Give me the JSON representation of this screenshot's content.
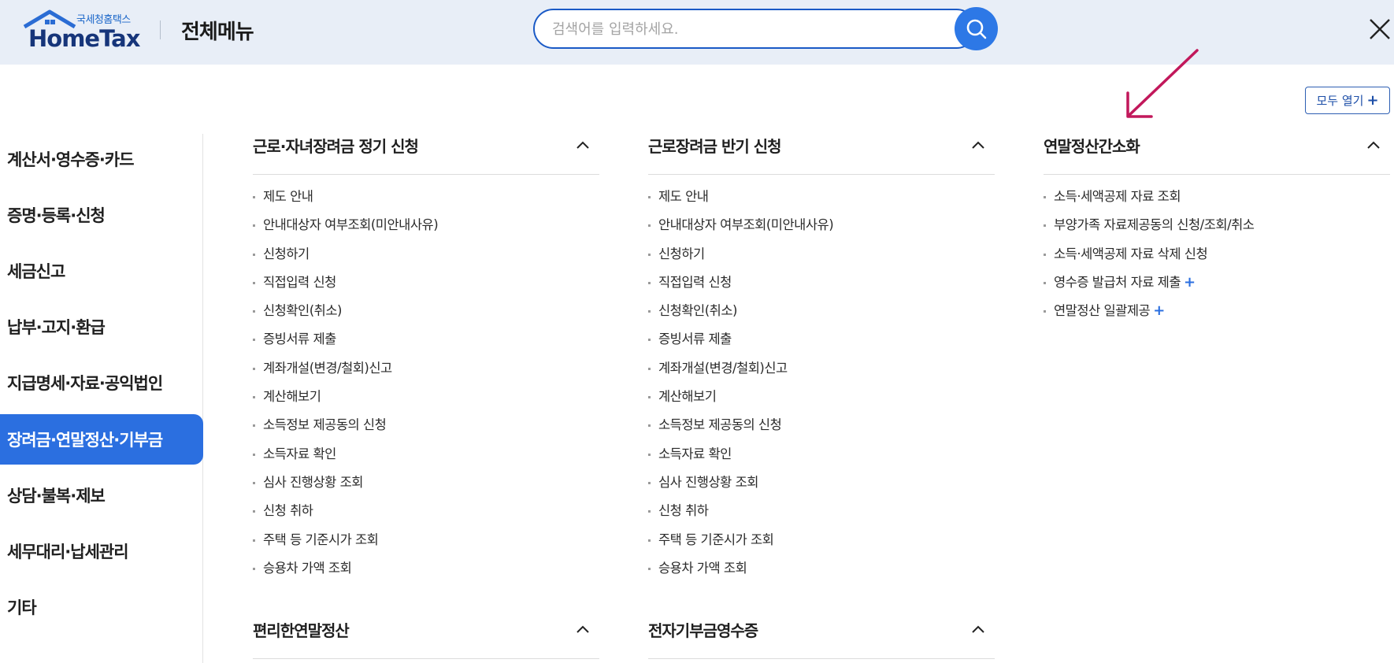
{
  "header": {
    "logo_sub": "국세청홈택스",
    "logo_main": "HomeTax",
    "page_title": "전체메뉴",
    "search_placeholder": "검색어를 입력하세요."
  },
  "expand_all_label": "모두 열기",
  "expand_all_icon": "+",
  "nav": [
    "계산서·영수증·카드",
    "증명·등록·신청",
    "세금신고",
    "납부·고지·환급",
    "지급명세·자료·공익법인",
    "장려금·연말정산·기부금",
    "상담·불복·제보",
    "세무대리·납세관리",
    "기타"
  ],
  "active_nav_index": 5,
  "columns": [
    {
      "title": "근로·자녀장려금 정기 신청",
      "links": [
        "제도 안내",
        "안내대상자 여부조회(미안내사유)",
        "신청하기",
        "직접입력 신청",
        "신청확인(취소)",
        "증빙서류 제출",
        "계좌개설(변경/철회)신고",
        "계산해보기",
        "소득정보 제공동의 신청",
        "소득자료 확인",
        "심사 진행상황 조회",
        "신청 취하",
        "주택 등 기준시가 조회",
        "승용차 가액 조회"
      ],
      "next_title": "편리한연말정산"
    },
    {
      "title": "근로장려금 반기 신청",
      "links": [
        "제도 안내",
        "안내대상자 여부조회(미안내사유)",
        "신청하기",
        "직접입력 신청",
        "신청확인(취소)",
        "증빙서류 제출",
        "계좌개설(변경/철회)신고",
        "계산해보기",
        "소득정보 제공동의 신청",
        "소득자료 확인",
        "심사 진행상황 조회",
        "신청 취하",
        "주택 등 기준시가 조회",
        "승용차 가액 조회"
      ],
      "next_title": "전자기부금영수증"
    },
    {
      "title": "연말정산간소화",
      "links": [
        "소득·세액공제 자료 조회",
        "부양가족 자료제공동의 신청/조회/취소",
        "소득·세액공제 자료 삭제 신청",
        "영수증 발급처 자료 제출",
        "연말정산 일괄제공"
      ],
      "more_links": [
        "영수증 발급처 자료 제출",
        "연말정산 일괄제공"
      ],
      "more_icon": "+"
    }
  ],
  "colors": {
    "accent": "#2b6fe0",
    "header_bg": "#e8eef7",
    "logo_navy": "#16357a",
    "annotation": "#c2185b"
  }
}
